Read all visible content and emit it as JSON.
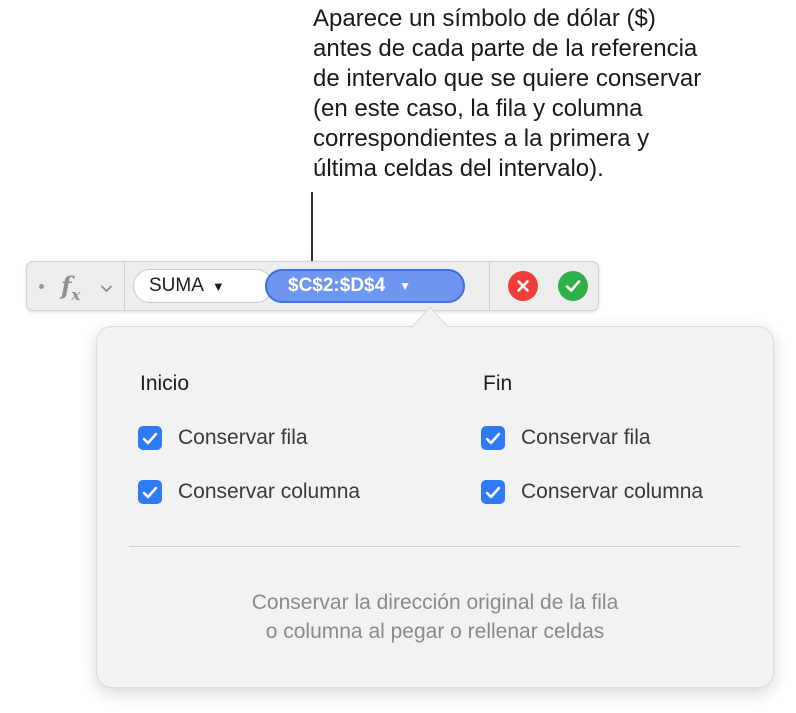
{
  "callout": {
    "lines": [
      "Aparece un símbolo de dólar ($)",
      "antes de cada parte de la referencia",
      "de intervalo que se quiere conservar",
      "(en este caso, la fila y columna",
      "correspondientes a la primera y",
      "última celdas del intervalo)."
    ]
  },
  "formula_bar": {
    "function_label": "SUMA",
    "function_arrow": "▼",
    "range_label": "$C$2:$D$4",
    "range_arrow": "▼"
  },
  "popover": {
    "start": {
      "title": "Inicio",
      "options": [
        {
          "label": "Conservar fila",
          "checked": true
        },
        {
          "label": "Conservar columna",
          "checked": true
        }
      ]
    },
    "end": {
      "title": "Fin",
      "options": [
        {
          "label": "Conservar fila",
          "checked": true
        },
        {
          "label": "Conservar columna",
          "checked": true
        }
      ]
    },
    "footer_lines": [
      "Conservar la dirección original de la fila",
      "o columna al pegar o rellenar celdas"
    ]
  },
  "colors": {
    "range_token": "#6e95ef",
    "checkbox": "#2f7af7",
    "cancel": "#ef3d3b",
    "accept": "#2fb047"
  }
}
